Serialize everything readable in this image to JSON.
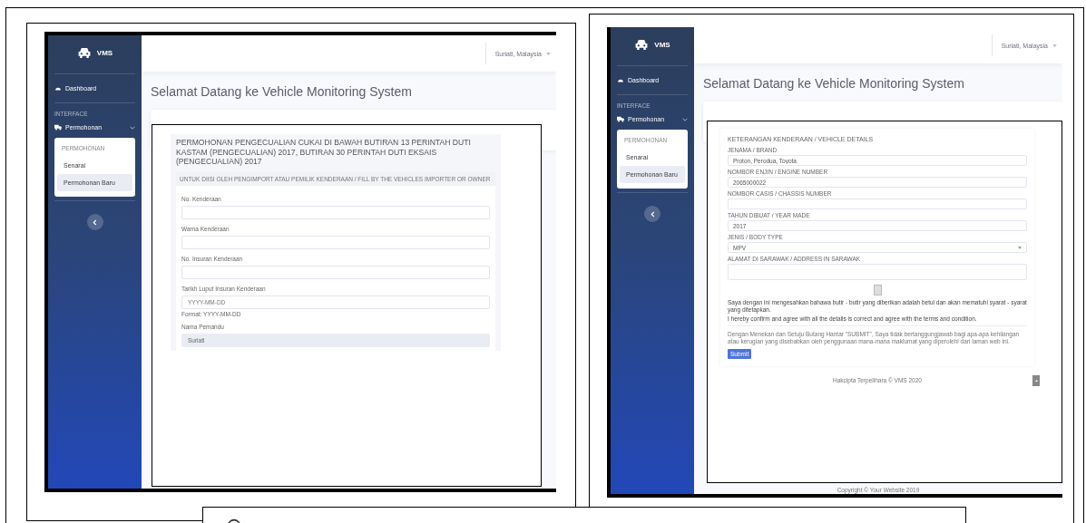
{
  "screens": [
    {
      "sidebar": {
        "brand": "VMS",
        "dashboard": "Dashboard",
        "section": "INTERFACE",
        "menu": {
          "label": "Permohonan",
          "expanded": true
        },
        "submenu_header": "PERMOHONAN",
        "items": [
          {
            "label": "Senarai",
            "selected": false
          },
          {
            "label": "Permohonan Baru",
            "selected": true
          }
        ]
      },
      "topbar": {
        "user": "Suriati, Malaysia"
      },
      "heading": "Selamat Datang ke Vehicle Monitoring System",
      "form": {
        "kind": "application",
        "title": "PERMOHONAN PENGECUALIAN CUKAI DI BAWAH BUTIRAN 13 PERINTAH DUTI KASTAM (PENGECUALIAN) 2017, BUTIRAN 30 PERINTAH DUTI EKSAIS (PENGECUALIAN) 2017",
        "subheader": "UNTUK DIISI OLEH PENGIMPORT ATAU PEMILIK KENDERAAN / FILL BY THE VEHICLES IMPORTER OR OWNER",
        "fields": [
          {
            "kind": "text",
            "label": "No. Kenderaan"
          },
          {
            "kind": "text",
            "label": "Warna Kenderaan"
          },
          {
            "kind": "text",
            "label": "No. Insuran Kenderaan"
          },
          {
            "kind": "text",
            "label": "Tarikh Luput Insuran Kenderaan",
            "placeholder": "YYYY-MM-DD",
            "help": "Format: YYYY-MM-DD"
          },
          {
            "kind": "readonly",
            "label": "Nama Pemandu",
            "value": "Suriati"
          }
        ]
      }
    },
    {
      "sidebar": {
        "brand": "VMS",
        "dashboard": "Dashboard",
        "section": "INTERFACE",
        "menu": {
          "label": "Permohonan",
          "expanded": true
        },
        "submenu_header": "PERMOHONAN",
        "items": [
          {
            "label": "Senarai",
            "selected": false
          },
          {
            "label": "Permohonan Baru",
            "selected": true
          }
        ]
      },
      "topbar": {
        "user": "Suriati, Malaysia"
      },
      "heading": "Selamat Datang ke Vehicle Monitoring System",
      "form": {
        "kind": "details",
        "title": "KETERANGAN KENDERAAN / VEHICLE DETAILS",
        "fields": [
          {
            "kind": "text",
            "label": "JENAMA / BRAND",
            "value": "Proton, Perodua, Toyota"
          },
          {
            "kind": "text",
            "label": "NOMBOR ENJIN / ENGINE NUMBER",
            "value": "2065000022"
          },
          {
            "kind": "text",
            "label": "NOMBOR CASIS / CHASSIS NUMBER"
          },
          {
            "kind": "text",
            "label": "TAHUN DIBUAT / YEAR MADE",
            "value": "2017"
          },
          {
            "kind": "select",
            "label": "JENIS / BODY TYPE",
            "value": "MPV"
          },
          {
            "kind": "textarea",
            "label": "ALAMAT DI SARAWAK / ADDRESS IN SARAWAK"
          }
        ],
        "agreed": false,
        "declaration": [
          "Saya dengan ini mengesahkan bahawa butir - butir yang diberikan adalah betul dan akan mematuhi syarat - syarat yang ditetapkan.",
          "I hereby confirm and agree with all the details is correct and agree with the terms and condition."
        ],
        "disclaimer": "Dengan Menekan dan Setuju Butang Hantar \"SUBMIT\", Saya tidak bertanggungjawab bagi apa-apa kehilangan atau kerugian yang disebabkan oleh penggunaan mana-mana maklumat yang diperolehi dari laman web ini.",
        "submit": "Submit",
        "footer": "Hakcipta Terpelihara © VMS 2020"
      },
      "copyright": "Copyright © Your Website 2019"
    }
  ]
}
